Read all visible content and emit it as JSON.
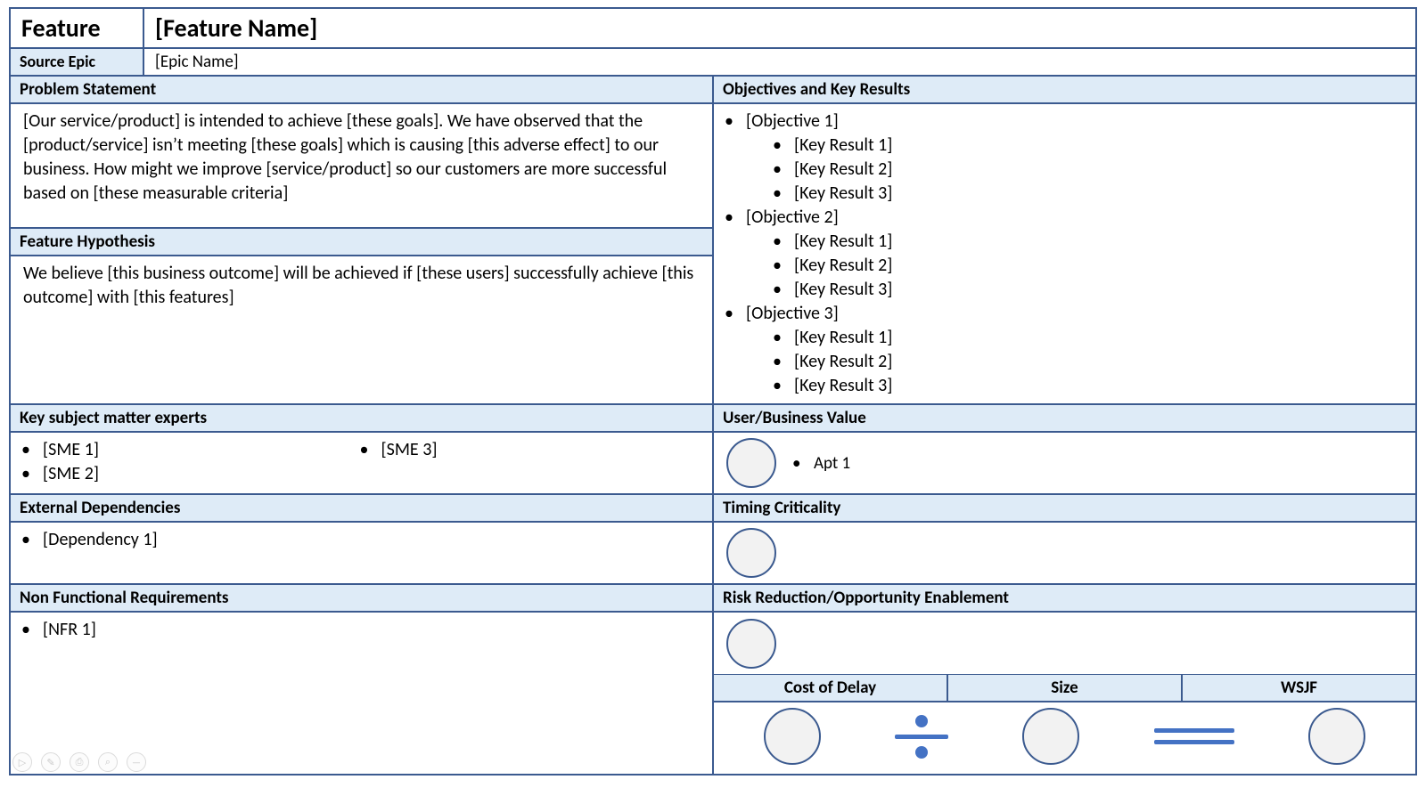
{
  "header": {
    "feature_label": "Feature",
    "feature_value": "[Feature Name]",
    "epic_label": "Source Epic",
    "epic_value": "[Epic Name]"
  },
  "left": {
    "problem_hdr": "Problem Statement",
    "problem_body": "[Our service/product] is intended to achieve [these goals].  We have observed that the [product/service] isn’t meeting [these goals] which is causing [this adverse effect] to our business.  How might we improve [service/product] so our customers are more successful based on [these measurable criteria]",
    "hypothesis_hdr": "Feature Hypothesis",
    "hypothesis_body": "We believe [this business outcome] will be achieved if [these users] successfully achieve [this outcome] with [this features]",
    "sme_hdr": "Key subject matter experts",
    "sme_items": [
      "[SME 1]",
      "[SME 2]",
      "[SME 3]"
    ],
    "deps_hdr": "External Dependencies",
    "deps_items": [
      "[Dependency 1]"
    ],
    "nfr_hdr": "Non Functional Requirements",
    "nfr_items": [
      "[NFR 1]"
    ]
  },
  "right": {
    "okr_hdr": "Objectives and Key Results",
    "okrs": [
      {
        "objective": "[Objective 1]",
        "krs": [
          "[Key Result 1]",
          "[Key Result 2]",
          "[Key Result 3]"
        ]
      },
      {
        "objective": "[Objective 2]",
        "krs": [
          "[Key Result 1]",
          "[Key Result 2]",
          "[Key Result 3]"
        ]
      },
      {
        "objective": "[Objective 3]",
        "krs": [
          "[Key Result 1]",
          "[Key Result 2]",
          "[Key Result 3]"
        ]
      }
    ],
    "ubv_hdr": "User/Business Value",
    "ubv_items": [
      "Apt 1"
    ],
    "timing_hdr": "Timing Criticality",
    "rroe_hdr": "Risk Reduction/Opportunity Enablement",
    "wsjf_labels": {
      "cod": "Cost of Delay",
      "size": "Size",
      "wsjf": "WSJF"
    }
  },
  "footer_icons": [
    "▷",
    "✎",
    "⎙",
    "⌕",
    "—"
  ]
}
